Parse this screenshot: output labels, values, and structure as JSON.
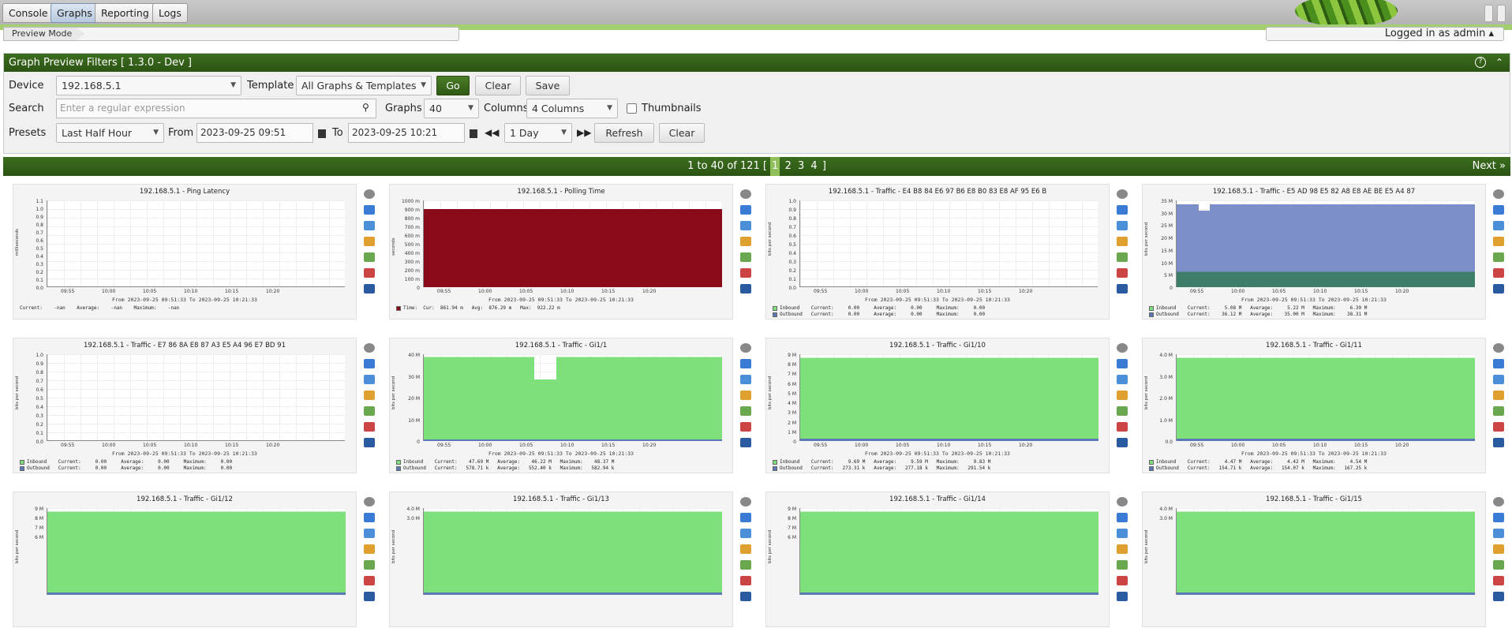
{
  "nav": {
    "tabs": [
      {
        "label": "Console",
        "active": false
      },
      {
        "label": "Graphs",
        "active": true
      },
      {
        "label": "Reporting",
        "active": false
      },
      {
        "label": "Logs",
        "active": false
      }
    ]
  },
  "status": {
    "mode": "Preview Mode",
    "user": "Logged in as admin"
  },
  "filters": {
    "title": "Graph Preview Filters [ 1.3.0 - Dev ]",
    "device_label": "Device",
    "device_value": "192.168.5.1",
    "template_label": "Template",
    "template_value": "All Graphs & Templates",
    "go_label": "Go",
    "clear_label": "Clear",
    "save_label": "Save",
    "search_label": "Search",
    "search_placeholder": "Enter a regular expression",
    "graphs_label": "Graphs",
    "graphs_value": "40",
    "columns_label": "Columns",
    "columns_value": "4 Columns",
    "thumbnails_label": "Thumbnails",
    "presets_label": "Presets",
    "presets_value": "Last Half Hour",
    "from_label": "From",
    "from_value": "2023-09-25 09:51",
    "to_label": "To",
    "to_value": "2023-09-25 10:21",
    "shift_value": "1 Day",
    "refresh_label": "Refresh",
    "clear2_label": "Clear"
  },
  "pager": {
    "summary": "1 to 40 of 121 [",
    "pages": [
      "1",
      "2",
      "3",
      "4"
    ],
    "close": "]",
    "next": "Next"
  },
  "colors": {
    "accent": "#2f5a13",
    "inbound": "#7de07a",
    "outbound": "#5978b5",
    "polling": "#8b0a1a",
    "traffic_e5": "#7d8fc8"
  },
  "x_ticks": [
    "09:55",
    "10:00",
    "10:05",
    "10:10",
    "10:15",
    "10:20"
  ],
  "graphs": [
    {
      "title": "192.168.5.1 - Ping Latency",
      "ylabel": "milliseconds",
      "yticks": [
        "1.1",
        "1.0",
        "0.9",
        "0.8",
        "0.7",
        "0.6",
        "0.5",
        "0.4",
        "0.3",
        "0.2",
        "0.1",
        "0.0"
      ],
      "type": "empty",
      "subtitle": "From 2023-09-25 09:51:33 To 2023-09-25 10:21:33",
      "legend": [
        "Current:    -nan    Average:    -nan    Maximum:    -nan"
      ],
      "legend_colors": []
    },
    {
      "title": "192.168.5.1 - Polling Time",
      "ylabel": "seconds",
      "yticks": [
        "1000 m",
        "900 m",
        "800 m",
        "700 m",
        "600 m",
        "500 m",
        "400 m",
        "300 m",
        "200 m",
        "100 m",
        "0"
      ],
      "type": "polling",
      "subtitle": "From 2023-09-25 09:51:33 To 2023-09-25 10:21:33",
      "legend": [
        "Time:  Cur:  861.94 m   Avg:  876.29 m   Max:  922.22 m"
      ],
      "legend_colors": [
        "#8b0a1a"
      ]
    },
    {
      "title": "192.168.5.1 - Traffic - E4 B8 84 E6 97 B6 E8 B0 83 E8 AF 95 E6 B",
      "ylabel": "bits per second",
      "yticks": [
        "1.0",
        "0.9",
        "0.8",
        "0.7",
        "0.6",
        "0.5",
        "0.4",
        "0.3",
        "0.2",
        "0.1",
        "0.0"
      ],
      "type": "empty",
      "subtitle": "From 2023-09-25 09:51:33 To 2023-09-25 10:21:33",
      "legend": [
        "Inbound    Current:     0.00     Average:     0.00     Maximum:     0.00",
        "Outbound   Current:     0.00     Average:     0.00     Maximum:     0.00"
      ],
      "legend_colors": [
        "#7de07a",
        "#5978b5"
      ]
    },
    {
      "title": "192.168.5.1 - Traffic - E5 AD 98 E5 82 A8 E8 AE BE E5 A4 87",
      "ylabel": "bits per second",
      "yticks": [
        "35 M",
        "30 M",
        "25 M",
        "20 M",
        "15 M",
        "10 M",
        "5 M",
        "0"
      ],
      "type": "e5",
      "subtitle": "From 2023-09-25 09:51:33 To 2023-09-25 10:21:33",
      "legend": [
        "Inbound    Current:     5.08 M   Average:     5.22 M   Maximum:     6.39 M",
        "Outbound   Current:    36.12 M   Average:    35.00 M   Maximum:    38.31 M"
      ],
      "legend_colors": [
        "#7de07a",
        "#5978b5"
      ]
    },
    {
      "title": "192.168.5.1 - Traffic - E7 86 8A E8 87 A3 E5 A4 96 E7 BD 91",
      "ylabel": "bits per second",
      "yticks": [
        "1.0",
        "0.9",
        "0.8",
        "0.7",
        "0.6",
        "0.5",
        "0.4",
        "0.3",
        "0.2",
        "0.1",
        "0.0"
      ],
      "type": "empty",
      "subtitle": "From 2023-09-25 09:51:33 To 2023-09-25 10:21:33",
      "legend": [
        "Inbound    Current:     0.00     Average:     0.00     Maximum:     0.00",
        "Outbound   Current:     0.00     Average:     0.00     Maximum:     0.00"
      ],
      "legend_colors": [
        "#7de07a",
        "#5978b5"
      ]
    },
    {
      "title": "192.168.5.1 - Traffic - Gi1/1",
      "ylabel": "bits per second",
      "yticks": [
        "40 M",
        "30 M",
        "20 M",
        "10 M",
        "0"
      ],
      "type": "green_dip",
      "subtitle": "From 2023-09-25 09:51:33 To 2023-09-25 10:21:33",
      "legend": [
        "Inbound    Current:    47.69 M   Average:    46.22 M   Maximum:    48.37 M",
        "Outbound   Current:   578.71 k   Average:   552.40 k   Maximum:   582.94 k"
      ],
      "legend_colors": [
        "#7de07a",
        "#5978b5"
      ]
    },
    {
      "title": "192.168.5.1 - Traffic - Gi1/10",
      "ylabel": "bits per second",
      "yticks": [
        "9 M",
        "8 M",
        "7 M",
        "6 M",
        "5 M",
        "4 M",
        "3 M",
        "2 M",
        "1 M",
        "0"
      ],
      "type": "green",
      "subtitle": "From 2023-09-25 09:51:33 To 2023-09-25 10:21:33",
      "legend": [
        "Inbound    Current:     9.69 M   Average:     9.59 M   Maximum:     9.83 M",
        "Outbound   Current:   273.31 k   Average:   277.18 k   Maximum:   291.54 k"
      ],
      "legend_colors": [
        "#7de07a",
        "#5978b5"
      ]
    },
    {
      "title": "192.168.5.1 - Traffic - Gi1/11",
      "ylabel": "bits per second",
      "yticks": [
        "4.0 M",
        "3.0 M",
        "2.0 M",
        "1.0 M",
        "0.0"
      ],
      "type": "green",
      "subtitle": "From 2023-09-25 09:51:33 To 2023-09-25 10:21:33",
      "legend": [
        "Inbound    Current:     4.47 M   Average:     4.42 M   Maximum:     4.54 M",
        "Outbound   Current:   154.71 k   Average:   154.07 k   Maximum:   167.25 k"
      ],
      "legend_colors": [
        "#7de07a",
        "#5978b5"
      ]
    },
    {
      "title": "192.168.5.1 - Traffic - Gi1/12",
      "ylabel": "bits per second",
      "yticks": [
        "9 M",
        "8 M",
        "7 M",
        "6 M"
      ],
      "type": "green",
      "subtitle": "",
      "legend": [],
      "legend_colors": []
    },
    {
      "title": "192.168.5.1 - Traffic - Gi1/13",
      "ylabel": "bits per second",
      "yticks": [
        "4.0 M",
        "3.0 M"
      ],
      "type": "green",
      "subtitle": "",
      "legend": [],
      "legend_colors": []
    },
    {
      "title": "192.168.5.1 - Traffic - Gi1/14",
      "ylabel": "bits per second",
      "yticks": [
        "9 M",
        "8 M",
        "7 M",
        "6 M"
      ],
      "type": "green",
      "subtitle": "",
      "legend": [],
      "legend_colors": []
    },
    {
      "title": "192.168.5.1 - Traffic - Gi1/15",
      "ylabel": "bits per second",
      "yticks": [
        "4.0 M",
        "3.0 M"
      ],
      "type": "green",
      "subtitle": "",
      "legend": [],
      "legend_colors": []
    }
  ],
  "graph_icons": [
    "gear-icon",
    "zoom-icon",
    "csv-icon",
    "edit-icon",
    "properties-icon",
    "realtime-icon",
    "expand-icon"
  ]
}
